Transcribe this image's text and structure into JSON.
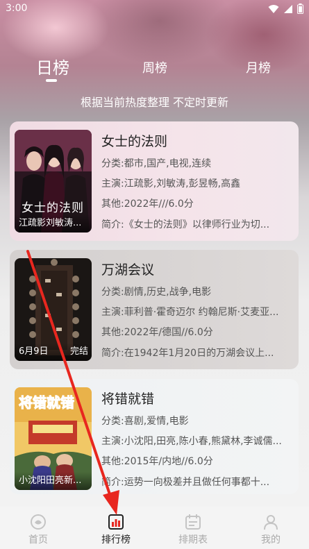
{
  "status_bar": {
    "time": "3:00"
  },
  "tabs": [
    {
      "label": "日榜",
      "active": true
    },
    {
      "label": "周榜",
      "active": false
    },
    {
      "label": "月榜",
      "active": false
    }
  ],
  "subtitle": "根据当前热度整理 不定时更新",
  "movies": [
    {
      "title": "女士的法则",
      "poster_caption": "江疏影刘敏涛...",
      "poster_text": "女士的法则",
      "genre_label": "分类:",
      "genre": "都市,国产,电视,连续",
      "cast_label": "主演:",
      "cast": "江疏影,刘敏涛,彭昱畅,高鑫",
      "other_label": "其他:",
      "other": "2022年///6.0分",
      "intro_label": "简介:",
      "intro": "《女士的法则》以律师行业为切..."
    },
    {
      "title": "万湖会议",
      "poster_caption": "6月9日",
      "poster_badge": "完结",
      "genre_label": "分类:",
      "genre": "剧情,历史,战争,电影",
      "cast_label": "主演:",
      "cast": "菲利普·霍奇迈尔 约翰尼斯·艾麦亚...",
      "other_label": "其他:",
      "other": "2022年/德国//6.0分",
      "intro_label": "简介:",
      "intro": "在1942年1月20日的万湖会议上..."
    },
    {
      "title": "将错就错",
      "poster_caption": "小沈阳田亮新...",
      "poster_text": "将错就错",
      "genre_label": "分类:",
      "genre": "喜剧,爱情,电影",
      "cast_label": "主演:",
      "cast": "小沈阳,田亮,陈小春,熊黛林,李诚儒...",
      "other_label": "其他:",
      "other": "2015年/内地//6.0分",
      "intro_label": "简介:",
      "intro": "运势一向极差并且做任何事都十..."
    }
  ],
  "bottom_nav": [
    {
      "label": "首页",
      "icon": "home-icon",
      "active": false
    },
    {
      "label": "排行榜",
      "icon": "ranking-icon",
      "active": true
    },
    {
      "label": "排期表",
      "icon": "schedule-icon",
      "active": false
    },
    {
      "label": "我的",
      "icon": "profile-icon",
      "active": false
    }
  ],
  "colors": {
    "accent": "#222222",
    "inactive": "#aaaaaa",
    "arrow": "#e8271f"
  }
}
